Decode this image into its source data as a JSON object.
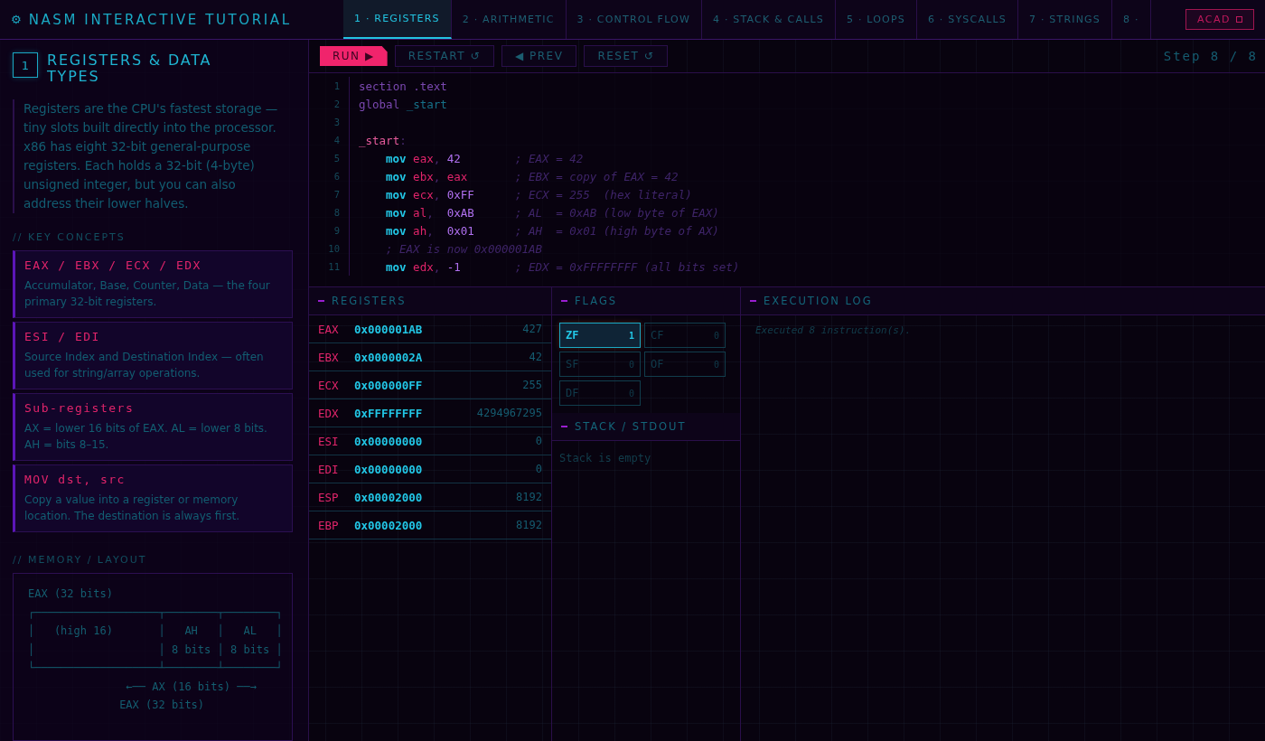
{
  "app": {
    "icon": "⚙",
    "title": "NASM INTERACTIVE TUTORIAL"
  },
  "tabs": [
    {
      "label": "1 · REGISTERS",
      "selected": true
    },
    {
      "label": "2 · ARITHMETIC",
      "selected": false
    },
    {
      "label": "3 · CONTROL FLOW",
      "selected": false
    },
    {
      "label": "4 · STACK & CALLS",
      "selected": false
    },
    {
      "label": "5 · LOOPS",
      "selected": false
    },
    {
      "label": "6 · SYSCALLS",
      "selected": false
    },
    {
      "label": "7 · STRINGS",
      "selected": false
    },
    {
      "label": "8 ·",
      "selected": false
    }
  ],
  "mode_button": {
    "label": "ACAD"
  },
  "lesson": {
    "number": "1",
    "title": "REGISTERS & DATA TYPES",
    "intro": "Registers are the CPU's fastest storage — tiny slots built directly into the processor. x86 has eight 32-bit general-purpose registers. Each holds a 32-bit (4-byte) unsigned integer, but you can also address their lower halves.",
    "concepts_heading": "// KEY CONCEPTS",
    "concepts": [
      {
        "term": "EAX / EBX / ECX / EDX",
        "description": "Accumulator, Base, Counter, Data — the four primary 32-bit registers."
      },
      {
        "term": "ESI / EDI",
        "description": "Source Index and Destination Index — often used for string/array operations."
      },
      {
        "term": "Sub-registers",
        "description": "AX = lower 16 bits of EAX. AL = lower 8 bits. AH = bits 8–15."
      },
      {
        "term": "MOV dst, src",
        "description": "Copy a value into a register or memory location. The destination is always first."
      }
    ],
    "memory_heading": "// MEMORY / LAYOUT",
    "diagram": [
      "EAX (32 bits)",
      "┌───────────────────┬────────┬────────┐",
      "│   (high 16)       │   AH   │   AL   │",
      "│                   │ 8 bits │ 8 bits │",
      "└───────────────────┴────────┴────────┘",
      "               ←── AX (16 bits) ──→",
      "              EAX (32 bits)"
    ]
  },
  "toolbar": {
    "buttons": [
      {
        "label": "RUN ▶",
        "kind": "primary"
      },
      {
        "label": "RESTART ↺",
        "kind": "secondary"
      },
      {
        "label": "◀ PREV",
        "kind": "secondary"
      },
      {
        "label": "RESET ↺",
        "kind": "secondary"
      }
    ],
    "step": "Step 8 / 8"
  },
  "code": [
    {
      "number": "1",
      "tokens": [
        {
          "kind": "directive",
          "text": "section .text"
        }
      ]
    },
    {
      "number": "2",
      "tokens": [
        {
          "kind": "directive",
          "text": "global "
        },
        {
          "kind": "symbol",
          "text": "_start"
        }
      ]
    },
    {
      "number": "3"
    },
    {
      "number": "4",
      "tokens": [
        {
          "kind": "label",
          "text": "_start"
        },
        {
          "kind": "punct",
          "text": ":"
        }
      ]
    },
    {
      "number": "5",
      "indented": true,
      "tokens": [
        {
          "kind": "op",
          "text": "mov"
        },
        {
          "kind": "reg",
          "text": " eax"
        },
        {
          "kind": "punct",
          "text": ", "
        },
        {
          "kind": "num",
          "text": "42        "
        },
        {
          "kind": "comment",
          "text": "; EAX = 42"
        }
      ]
    },
    {
      "number": "6",
      "indented": true,
      "tokens": [
        {
          "kind": "op",
          "text": "mov"
        },
        {
          "kind": "reg",
          "text": " ebx"
        },
        {
          "kind": "punct",
          "text": ", "
        },
        {
          "kind": "reg",
          "text": "eax       "
        },
        {
          "kind": "comment",
          "text": "; EBX = copy of EAX = 42"
        }
      ]
    },
    {
      "number": "7",
      "indented": true,
      "tokens": [
        {
          "kind": "op",
          "text": "mov"
        },
        {
          "kind": "reg",
          "text": " ecx"
        },
        {
          "kind": "punct",
          "text": ", "
        },
        {
          "kind": "num",
          "text": "0xFF      "
        },
        {
          "kind": "comment",
          "text": "; ECX = 255  (hex literal)"
        }
      ]
    },
    {
      "number": "8",
      "indented": true,
      "tokens": [
        {
          "kind": "op",
          "text": "mov"
        },
        {
          "kind": "reg",
          "text": " al"
        },
        {
          "kind": "punct",
          "text": ",  "
        },
        {
          "kind": "num",
          "text": "0xAB      "
        },
        {
          "kind": "comment",
          "text": "; AL  = 0xAB (low byte of EAX)"
        }
      ]
    },
    {
      "number": "9",
      "indented": true,
      "tokens": [
        {
          "kind": "op",
          "text": "mov"
        },
        {
          "kind": "reg",
          "text": " ah"
        },
        {
          "kind": "punct",
          "text": ",  "
        },
        {
          "kind": "num",
          "text": "0x01      "
        },
        {
          "kind": "comment",
          "text": "; AH  = 0x01 (high byte of AX)"
        }
      ]
    },
    {
      "number": "10",
      "indented": true,
      "tokens": [
        {
          "kind": "comment",
          "text": "; EAX is now 0x000001AB"
        }
      ]
    },
    {
      "number": "11",
      "indented": true,
      "tokens": [
        {
          "kind": "op",
          "text": "mov"
        },
        {
          "kind": "reg",
          "text": " edx"
        },
        {
          "kind": "punct",
          "text": ", "
        },
        {
          "kind": "num",
          "text": "-1        "
        },
        {
          "kind": "comment",
          "text": "; EDX = 0xFFFFFFFF (all bits set)"
        }
      ]
    }
  ],
  "registers": {
    "heading": "REGISTERS",
    "rows": [
      {
        "name": "EAX",
        "hex": "0x000001AB",
        "decimal": "427"
      },
      {
        "name": "EBX",
        "hex": "0x0000002A",
        "decimal": "42"
      },
      {
        "name": "ECX",
        "hex": "0x000000FF",
        "decimal": "255"
      },
      {
        "name": "EDX",
        "hex": "0xFFFFFFFF",
        "decimal": "4294967295"
      },
      {
        "name": "ESI",
        "hex": "0x00000000",
        "decimal": "0"
      },
      {
        "name": "EDI",
        "hex": "0x00000000",
        "decimal": "0"
      },
      {
        "name": "ESP",
        "hex": "0x00002000",
        "decimal": "8192"
      },
      {
        "name": "EBP",
        "hex": "0x00002000",
        "decimal": "8192"
      }
    ]
  },
  "flags": {
    "heading": "FLAGS",
    "items": [
      {
        "name": "ZF",
        "value": "1",
        "set": true
      },
      {
        "name": "CF",
        "value": "0",
        "set": false
      },
      {
        "name": "SF",
        "value": "0",
        "set": false
      },
      {
        "name": "OF",
        "value": "0",
        "set": false
      },
      {
        "name": "DF",
        "value": "0",
        "set": false
      }
    ]
  },
  "stack": {
    "heading": "STACK / STDOUT",
    "empty_text": "Stack is empty"
  },
  "log": {
    "heading": "EXECUTION LOG",
    "entries": [
      "Executed 8 instruction(s)."
    ]
  }
}
